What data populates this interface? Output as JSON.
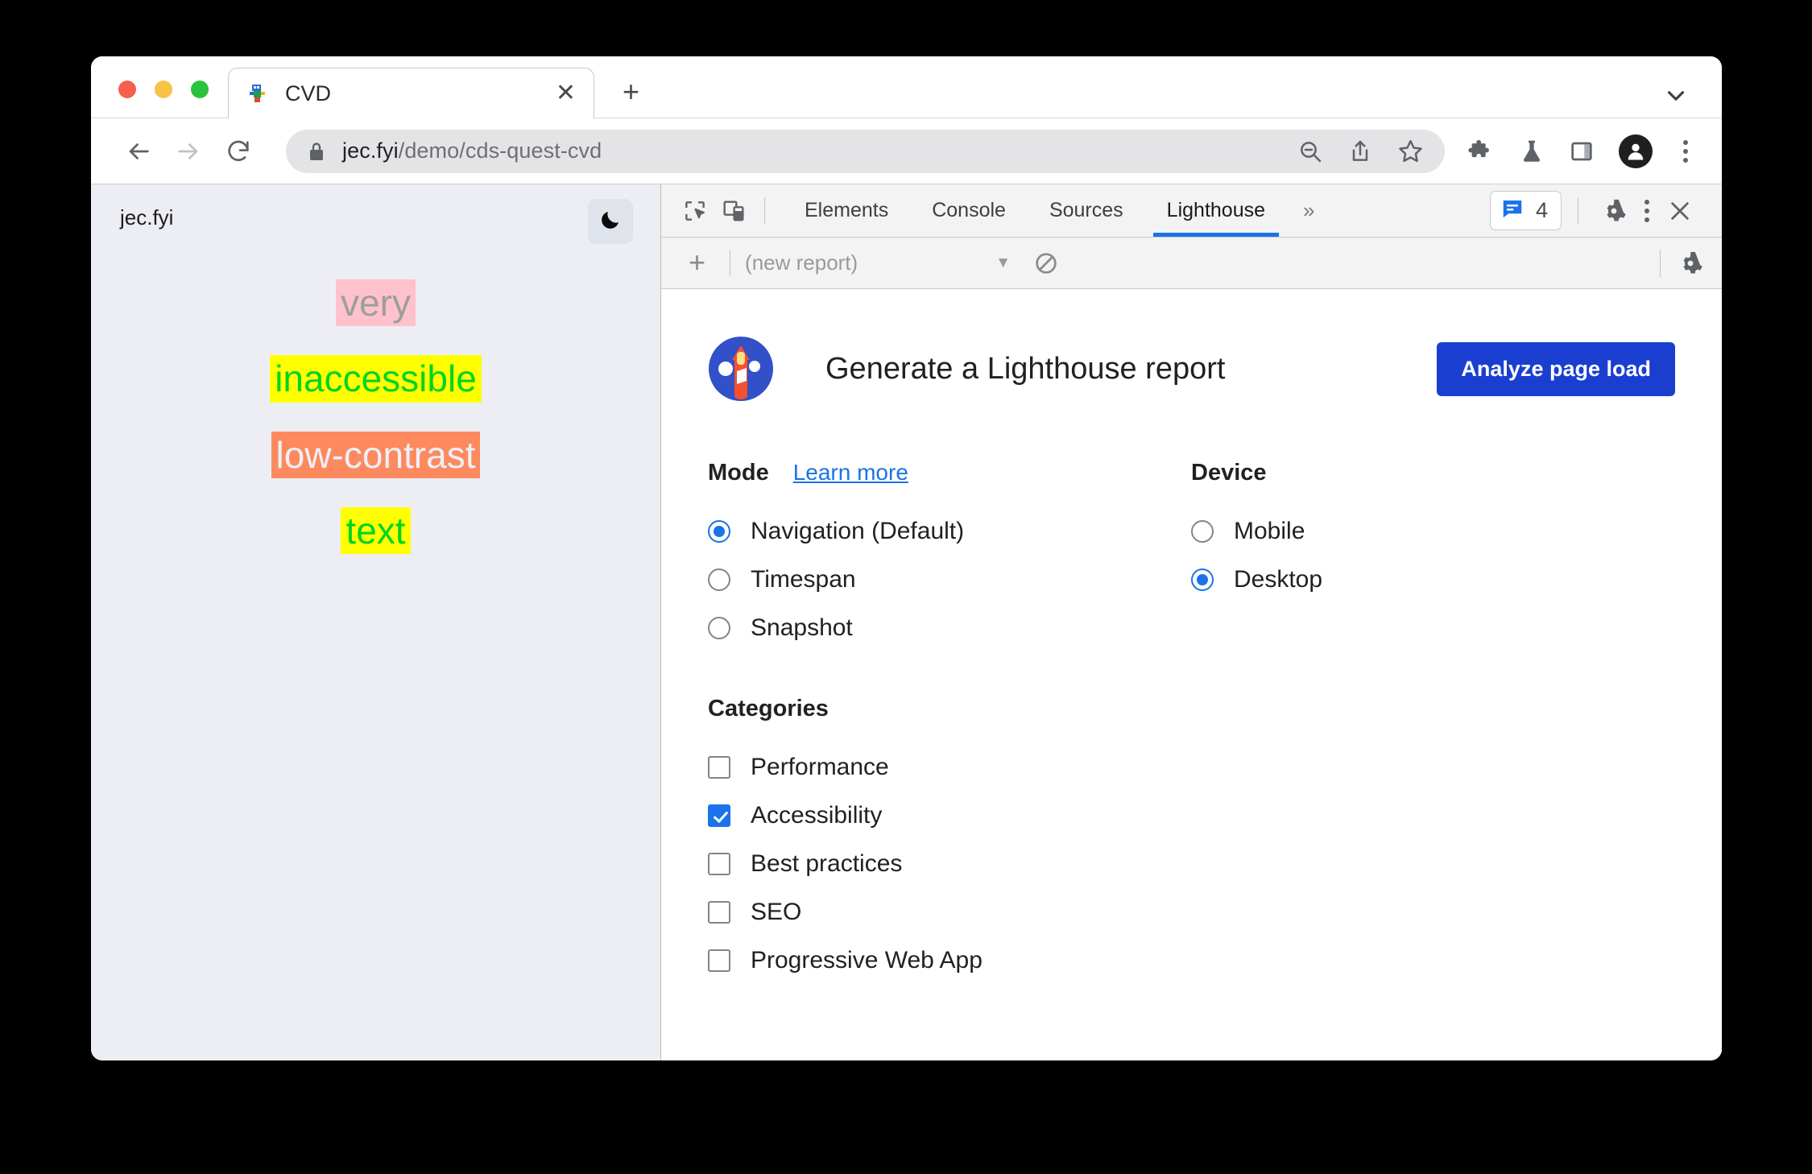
{
  "browser": {
    "traffic_lights": [
      "close",
      "minimize",
      "maximize"
    ],
    "tab": {
      "title": "CVD",
      "favicon": "chrome-dino-favicon",
      "close_label": "✕"
    },
    "new_tab_label": "+",
    "tab_search_icon": "chevron-down-icon",
    "nav": {
      "back": "back-arrow-icon",
      "forward": "forward-arrow-icon",
      "reload": "reload-icon"
    },
    "omnibox": {
      "lock_icon": "lock-icon",
      "url_host": "jec.fyi",
      "url_path": "/demo/cds-quest-cvd",
      "actions": [
        "zoom-out-icon",
        "share-icon",
        "bookmark-star-icon"
      ]
    },
    "toolbar_icons": [
      "extensions-puzzle-icon",
      "experiments-flask-icon",
      "side-panel-icon",
      "profile-avatar-icon",
      "chrome-menu-kebab-icon"
    ]
  },
  "page": {
    "site_label": "jec.fyi",
    "dark_mode_toggle": "moon-icon",
    "samples": [
      {
        "text": "very",
        "color": "#9e9e9e",
        "background": "#ffc2cc"
      },
      {
        "text": "inaccessible",
        "color": "#00d424",
        "background": "#ffff00"
      },
      {
        "text": "low-contrast",
        "color": "#edf0f7",
        "background": "#fd8a5e"
      },
      {
        "text": "text",
        "color": "#00d424",
        "background": "#ffff00"
      }
    ]
  },
  "devtools": {
    "left_icons": [
      "inspect-element-icon",
      "device-toolbar-icon"
    ],
    "tabs": [
      {
        "label": "Elements",
        "active": false
      },
      {
        "label": "Console",
        "active": false
      },
      {
        "label": "Sources",
        "active": false
      },
      {
        "label": "Lighthouse",
        "active": true
      }
    ],
    "overflow_label": "»",
    "messages": {
      "icon": "message-bubble-icon",
      "count": "4"
    },
    "right_icons": [
      "settings-gear-icon",
      "devtools-menu-kebab-icon",
      "close-devtools-icon"
    ],
    "report_toolbar": {
      "add_label": "+",
      "report_name": "(new report)",
      "caret": "▼",
      "clear_icon": "clear-prohibited-icon",
      "settings_icon": "settings-gear-icon"
    },
    "lighthouse": {
      "logo": "lighthouse-logo",
      "title": "Generate a Lighthouse report",
      "analyze_button": "Analyze page load",
      "mode": {
        "title": "Mode",
        "learn_more": "Learn more",
        "options": [
          {
            "label": "Navigation (Default)",
            "selected": true
          },
          {
            "label": "Timespan",
            "selected": false
          },
          {
            "label": "Snapshot",
            "selected": false
          }
        ]
      },
      "device": {
        "title": "Device",
        "options": [
          {
            "label": "Mobile",
            "selected": false
          },
          {
            "label": "Desktop",
            "selected": true
          }
        ]
      },
      "categories": {
        "title": "Categories",
        "options": [
          {
            "label": "Performance",
            "checked": false
          },
          {
            "label": "Accessibility",
            "checked": true
          },
          {
            "label": "Best practices",
            "checked": false
          },
          {
            "label": "SEO",
            "checked": false
          },
          {
            "label": "Progressive Web App",
            "checked": false
          }
        ]
      }
    }
  },
  "colors": {
    "accent_blue": "#1a73e8",
    "analyze_button_blue": "#1a3fd0",
    "page_bg": "#eceef4"
  }
}
